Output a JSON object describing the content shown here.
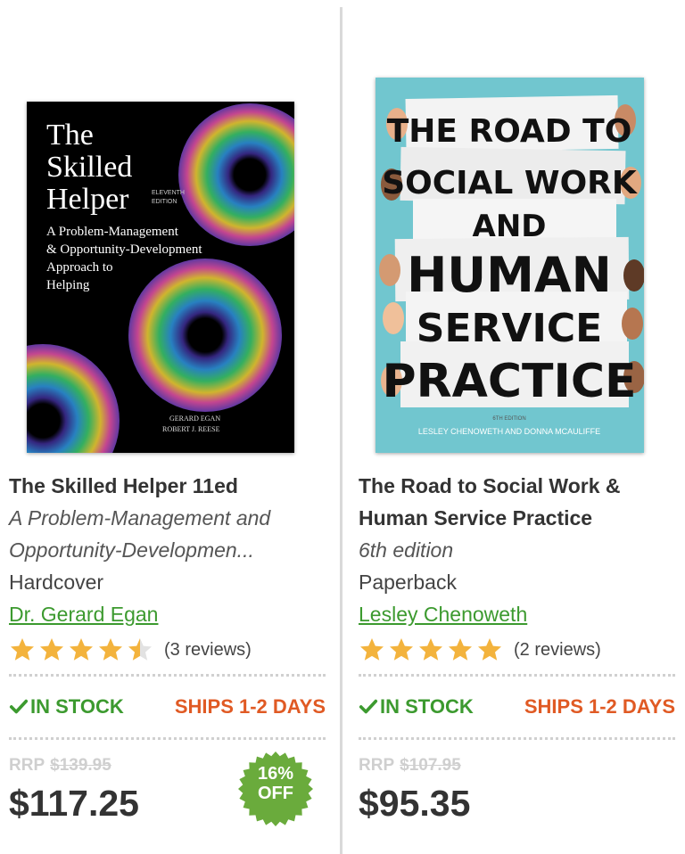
{
  "products": [
    {
      "cover": {
        "lines": [
          "The",
          "Skilled",
          "Helper"
        ],
        "edition": [
          "ELEVENTH",
          "EDITION"
        ],
        "subtitle_lines": [
          "A Problem-Management",
          "& Opportunity-Development",
          "Approach to",
          "Helping"
        ],
        "authors": [
          "GERARD EGAN",
          "ROBERT J. REESE"
        ]
      },
      "title": "The Skilled Helper 11ed",
      "subtitle_line1": "A Problem-Management and",
      "subtitle_line2": "Opportunity-Developmen...",
      "format": "Hardcover",
      "author": "Dr. Gerard Egan",
      "rating": 4.5,
      "reviews": "(3 reviews)",
      "stock": "IN STOCK",
      "ships": "SHIPS 1-2 DAYS",
      "rrp_label": "RRP",
      "rrp_value": "$139.95",
      "price": "$117.25",
      "discount": [
        "16%",
        "OFF"
      ]
    },
    {
      "cover": {
        "lines": [
          "THE ROAD TO",
          "SOCIAL WORK",
          "AND",
          "HUMAN",
          "SERVICE",
          "PRACTICE"
        ],
        "edition": "6TH EDITION",
        "authors": "LESLEY CHENOWETH AND DONNA MCAULIFFE"
      },
      "title_line1": "The Road to Social Work &",
      "title_line2": "Human Service Practice",
      "subtitle": "6th edition",
      "format": "Paperback",
      "author": "Lesley Chenoweth",
      "rating": 5,
      "reviews": "(2 reviews)",
      "stock": "IN STOCK",
      "ships": "SHIPS 1-2 DAYS",
      "rrp_label": "RRP",
      "rrp_value": "$107.95",
      "price": "$95.35"
    }
  ],
  "colors": {
    "link_green": "#3c9a2f",
    "ships_orange": "#e05a24",
    "star_gold": "#f3b33d",
    "badge_green": "#6aab3c"
  }
}
